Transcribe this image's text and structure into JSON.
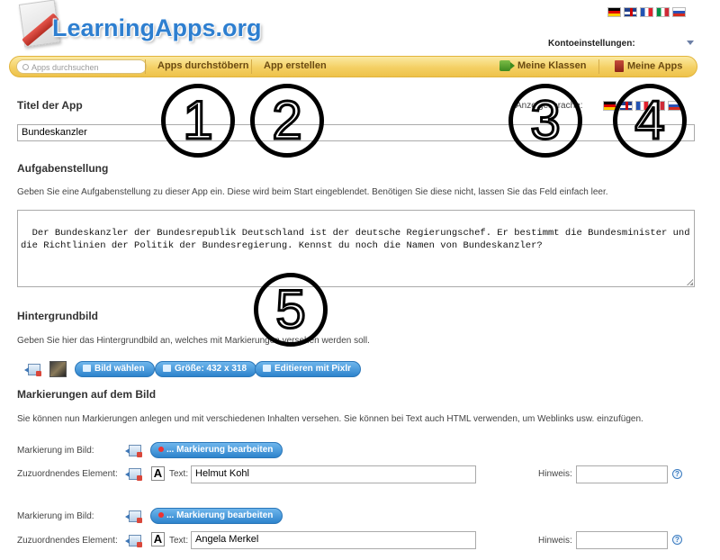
{
  "header": {
    "logo_text": "LearningApps.org",
    "account_label": "Kontoeinstellungen:",
    "flags": [
      "de",
      "gb",
      "fr",
      "it",
      "ru"
    ]
  },
  "nav": {
    "search_placeholder": "Apps durchsuchen",
    "browse": "Apps durchstöbern",
    "create": "App erstellen",
    "classes": "Meine Klassen",
    "my_apps": "Meine Apps"
  },
  "annotations": [
    "1",
    "2",
    "3",
    "4",
    "5"
  ],
  "title_section": {
    "heading": "Titel der App",
    "lang_label": "Anzeigesprache:",
    "value": "Bundeskanzler"
  },
  "task_section": {
    "heading": "Aufgabenstellung",
    "hint": "Geben Sie eine Aufgabenstellung zu dieser App ein. Diese wird beim Start eingeblendet. Benötigen Sie diese nicht, lassen Sie das Feld einfach leer.",
    "value": "Der Bundeskanzler der Bundesrepublik Deutschland ist der deutsche Regierungschef. Er bestimmt die Bundesminister und\ndie Richtlinien der Politik der Bundesregierung. Kennst du noch die Namen von Bundeskanzler?"
  },
  "background_section": {
    "heading": "Hintergrundbild",
    "hint": "Geben Sie hier das Hintergrundbild an, welches mit Markierungen versehen werden soll.",
    "btn_choose": "Bild wählen",
    "btn_size": "Größe: 432 x 318",
    "btn_pixlr": "Editieren mit Pixlr"
  },
  "markers_section": {
    "heading": "Markierungen auf dem Bild",
    "hint": "Sie können nun Markierungen anlegen und mit verschiedenen Inhalten versehen. Sie können bei Text auch HTML verwenden, um Weblinks usw. einzufügen.",
    "marker_label": "Markierung im Bild:",
    "element_label": "Zuzuordnendes Element:",
    "edit_button": "... Markierung bearbeiten",
    "text_label": "Text:",
    "hint_label": "Hinweis:",
    "items": [
      {
        "text": "Helmut Kohl",
        "hint": ""
      },
      {
        "text": "Angela Merkel",
        "hint": ""
      }
    ]
  }
}
